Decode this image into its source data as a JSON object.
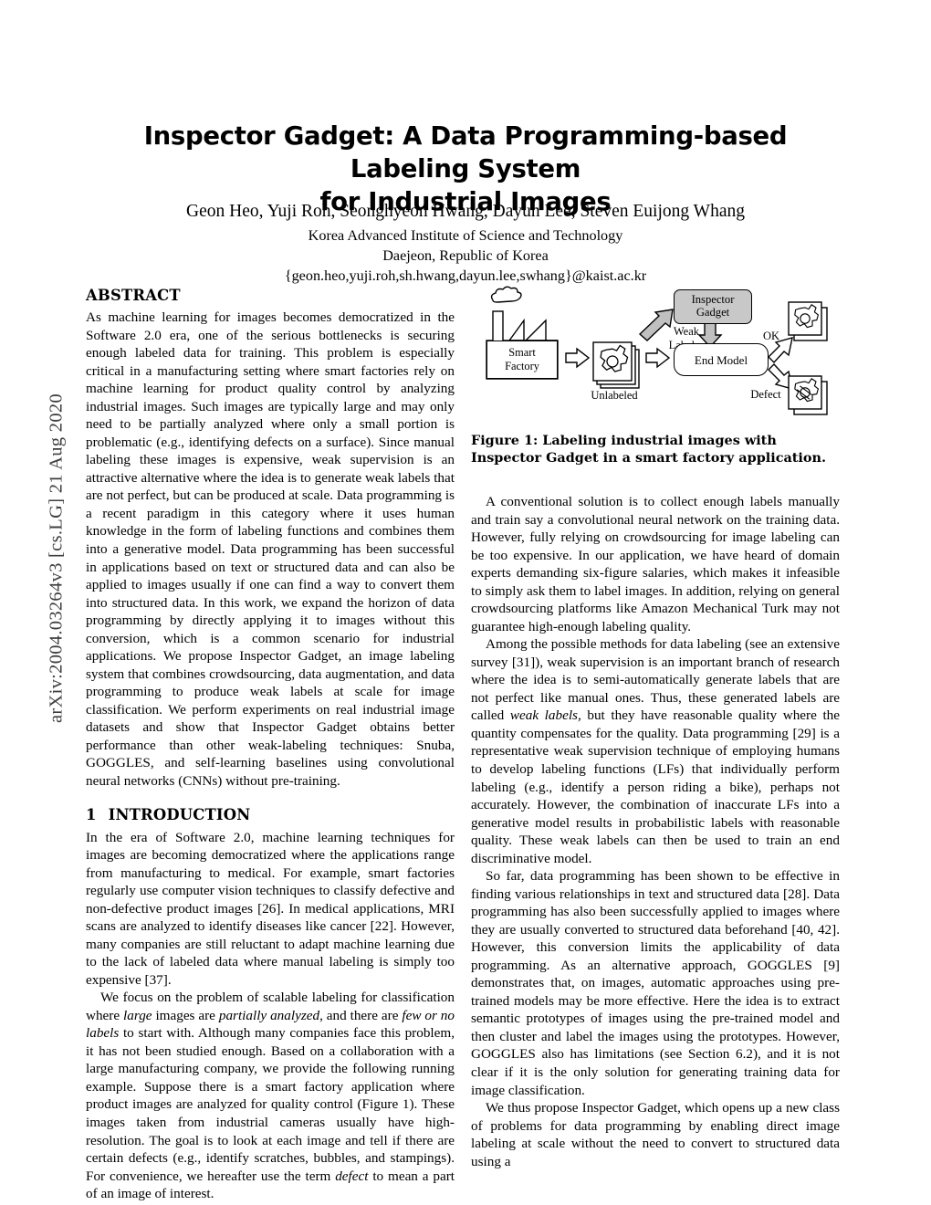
{
  "arxiv_stamp": "arXiv:2004.03264v3  [cs.LG]  21 Aug 2020",
  "title": {
    "line1": "Inspector Gadget: A Data Programming-based Labeling System",
    "line2": "for Industrial Images"
  },
  "authors": {
    "names": "Geon Heo, Yuji Roh, Seonghyeon Hwang, Dayun Lee, Steven Euijong Whang",
    "institution": "Korea Advanced Institute of Science and Technology",
    "location": "Daejeon, Republic of Korea",
    "emails": "{geon.heo,yuji.roh,sh.hwang,dayun.lee,swhang}@kaist.ac.kr"
  },
  "abstract": {
    "heading": "ABSTRACT",
    "text": "As machine learning for images becomes democratized in the Software 2.0 era, one of the serious bottlenecks is securing enough labeled data for training. This problem is especially critical in a manufacturing setting where smart factories rely on machine learning for product quality control by analyzing industrial images. Such images are typically large and may only need to be partially analyzed where only a small portion is problematic (e.g., identifying defects on a surface). Since manual labeling these images is expensive, weak supervision is an attractive alternative where the idea is to generate weak labels that are not perfect, but can be produced at scale. Data programming is a recent paradigm in this category where it uses human knowledge in the form of labeling functions and combines them into a generative model. Data programming has been successful in applications based on text or structured data and can also be applied to images usually if one can find a way to convert them into structured data. In this work, we expand the horizon of data programming by directly applying it to images without this conversion, which is a common scenario for industrial applications. We propose Inspector Gadget, an image labeling system that combines crowdsourcing, data augmentation, and data programming to produce weak labels at scale for image classification. We perform experiments on real industrial image datasets and show that Inspector Gadget obtains better performance than other weak-labeling techniques: Snuba, GOGGLES, and self-learning baselines using convolutional neural networks (CNNs) without pre-training."
  },
  "introduction": {
    "number": "1",
    "heading": "INTRODUCTION",
    "para1": "In the era of Software 2.0, machine learning techniques for images are becoming democratized where the applications range from manufacturing to medical. For example, smart factories regularly use computer vision techniques to classify defective and non-defective product images [26]. In medical applications, MRI scans are analyzed to identify diseases like cancer [22]. However, many companies are still reluctant to adapt machine learning due to the lack of labeled data where manual labeling is simply too expensive [37].",
    "para2_a": "We focus on the problem of scalable labeling for classification where ",
    "para2_i1": "large",
    "para2_b": " images are ",
    "para2_i2": "partially analyzed",
    "para2_c": ", and there are ",
    "para2_i3": "few or no labels",
    "para2_d": " to start with. Although many companies face this problem, it has not been studied enough. Based on a collaboration with a large manufacturing company, we provide the following running example. Suppose there is a smart factory application where product images are analyzed for quality control (Figure 1). These images taken from industrial cameras usually have high-resolution. The goal is to look at each image and tell if there are certain defects (e.g., identify scratches, bubbles, and stampings). For convenience, we hereafter use the term ",
    "para2_i4": "defect",
    "para2_e": " to mean a part of an image of interest."
  },
  "figure": {
    "caption": "Figure 1: Labeling industrial images with Inspector Gadget in a smart factory application.",
    "nodes": {
      "smart_factory": "Smart\nFactory",
      "unlabeled": "Unlabeled",
      "inspector_gadget": "Inspector\nGadget",
      "weak_labels": "Weak\nLabels",
      "end_model": "End Model",
      "ok": "OK",
      "defect": "Defect"
    },
    "colors": {
      "inspector_gadget_fill": "#c8c8c8",
      "arrow_fill_gray": "#c0c0c0",
      "arrow_fill_white": "#ffffff",
      "stroke": "#000000"
    }
  },
  "right_column": {
    "para1": "A conventional solution is to collect enough labels manually and train say a convolutional neural network on the training data. However, fully relying on crowdsourcing for image labeling can be too expensive. In our application, we have heard of domain experts demanding six-figure salaries, which makes it infeasible to simply ask them to label images. In addition, relying on general crowdsourcing platforms like Amazon Mechanical Turk may not guarantee high-enough labeling quality.",
    "para2_a": "Among the possible methods for data labeling (see an extensive survey [31]), weak supervision is an important branch of research where the idea is to semi-automatically generate labels that are not perfect like manual ones. Thus, these generated labels are called ",
    "para2_i1": "weak labels",
    "para2_b": ", but they have reasonable quality where the quantity compensates for the quality. Data programming [29] is a representative weak supervision technique of employing humans to develop labeling functions (LFs) that individually perform labeling (e.g., identify a person riding a bike), perhaps not accurately. However, the combination of inaccurate LFs into a generative model results in probabilistic labels with reasonable quality. These weak labels can then be used to train an end discriminative model.",
    "para3": "So far, data programming has been shown to be effective in finding various relationships in text and structured data [28]. Data programming has also been successfully applied to images where they are usually converted to structured data beforehand [40, 42]. However, this conversion limits the applicability of data programming. As an alternative approach, GOGGLES [9] demonstrates that, on images, automatic approaches using pre-trained models may be more effective. Here the idea is to extract semantic prototypes of images using the pre-trained model and then cluster and label the images using the prototypes. However, GOGGLES also has limitations (see Section 6.2), and it is not clear if it is the only solution for generating training data for image classification.",
    "para4": "We thus propose Inspector Gadget, which opens up a new class of problems for data programming by enabling direct image labeling at scale without the need to convert to structured data using a"
  }
}
